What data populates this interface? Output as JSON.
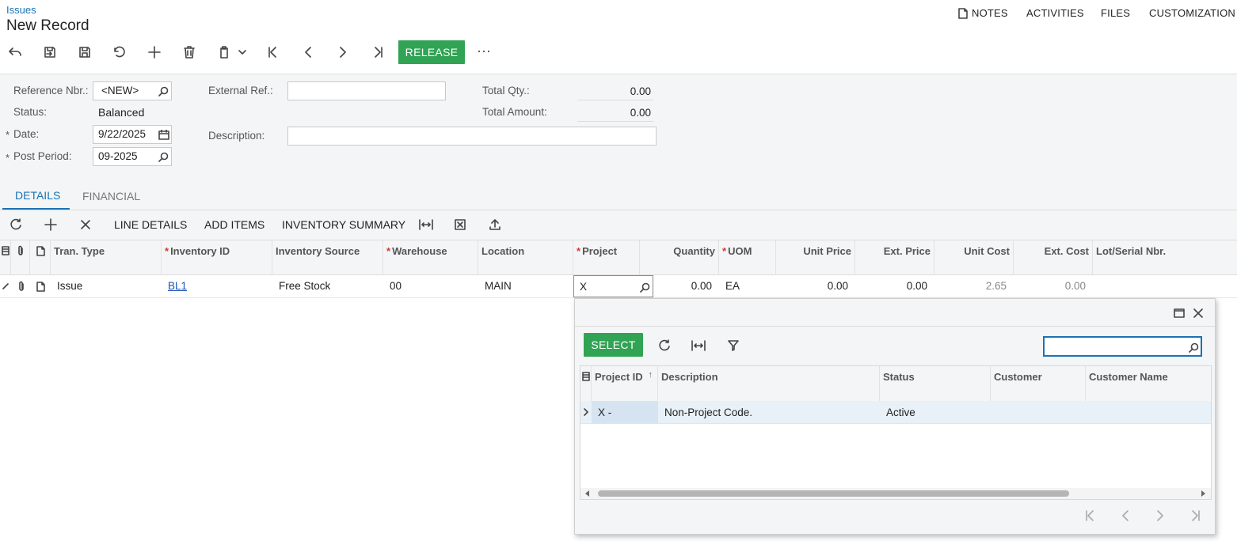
{
  "header": {
    "breadcrumb": "Issues",
    "title": "New Record",
    "links": {
      "notes": "NOTES",
      "activities": "ACTIVITIES",
      "files": "FILES",
      "customization": "CUSTOMIZATION"
    }
  },
  "toolbar": {
    "release_label": "RELEASE",
    "more_label": "···"
  },
  "form": {
    "ref_nbr_label": "Reference Nbr.:",
    "ref_nbr_value": "<NEW>",
    "status_label": "Status:",
    "status_value": "Balanced",
    "date_label": "Date:",
    "date_value": "9/22/2025",
    "post_period_label": "Post Period:",
    "post_period_value": "09-2025",
    "external_ref_label": "External Ref.:",
    "external_ref_value": "",
    "description_label": "Description:",
    "description_value": "",
    "total_qty_label": "Total Qty.:",
    "total_qty_value": "0.00",
    "total_amount_label": "Total Amount:",
    "total_amount_value": "0.00",
    "required_mark": "*"
  },
  "tabs": {
    "details": "DETAILS",
    "financial": "FINANCIAL"
  },
  "grid_toolbar": {
    "line_details": "LINE DETAILS",
    "add_items": "ADD ITEMS",
    "inventory_summary": "INVENTORY SUMMARY"
  },
  "grid": {
    "columns": {
      "tran_type": "Tran. Type",
      "inventory_id": "Inventory ID",
      "inventory_source": "Inventory Source",
      "warehouse": "Warehouse",
      "location": "Location",
      "project": "Project",
      "quantity": "Quantity",
      "uom": "UOM",
      "unit_price": "Unit Price",
      "ext_price": "Ext. Price",
      "unit_cost": "Unit Cost",
      "ext_cost": "Ext. Cost",
      "lot_serial": "Lot/Serial Nbr."
    },
    "row": {
      "tran_type": "Issue",
      "inventory_id": "BL1",
      "inventory_source": "Free Stock",
      "warehouse": "00",
      "location": "MAIN",
      "project": "X",
      "quantity": "0.00",
      "uom": "EA",
      "unit_price": "0.00",
      "ext_price": "0.00",
      "unit_cost": "2.65",
      "ext_cost": "0.00"
    }
  },
  "lookup": {
    "select_label": "SELECT",
    "search_value": "",
    "columns": {
      "project_id": "Project ID",
      "description": "Description",
      "status": "Status",
      "customer": "Customer",
      "customer_name": "Customer Name"
    },
    "row": {
      "project_id": "X -",
      "description": "Non-Project Code.",
      "status": "Active"
    }
  },
  "colors": {
    "accent": "#1a73b5",
    "green": "#31a354",
    "required": "#d33333"
  }
}
